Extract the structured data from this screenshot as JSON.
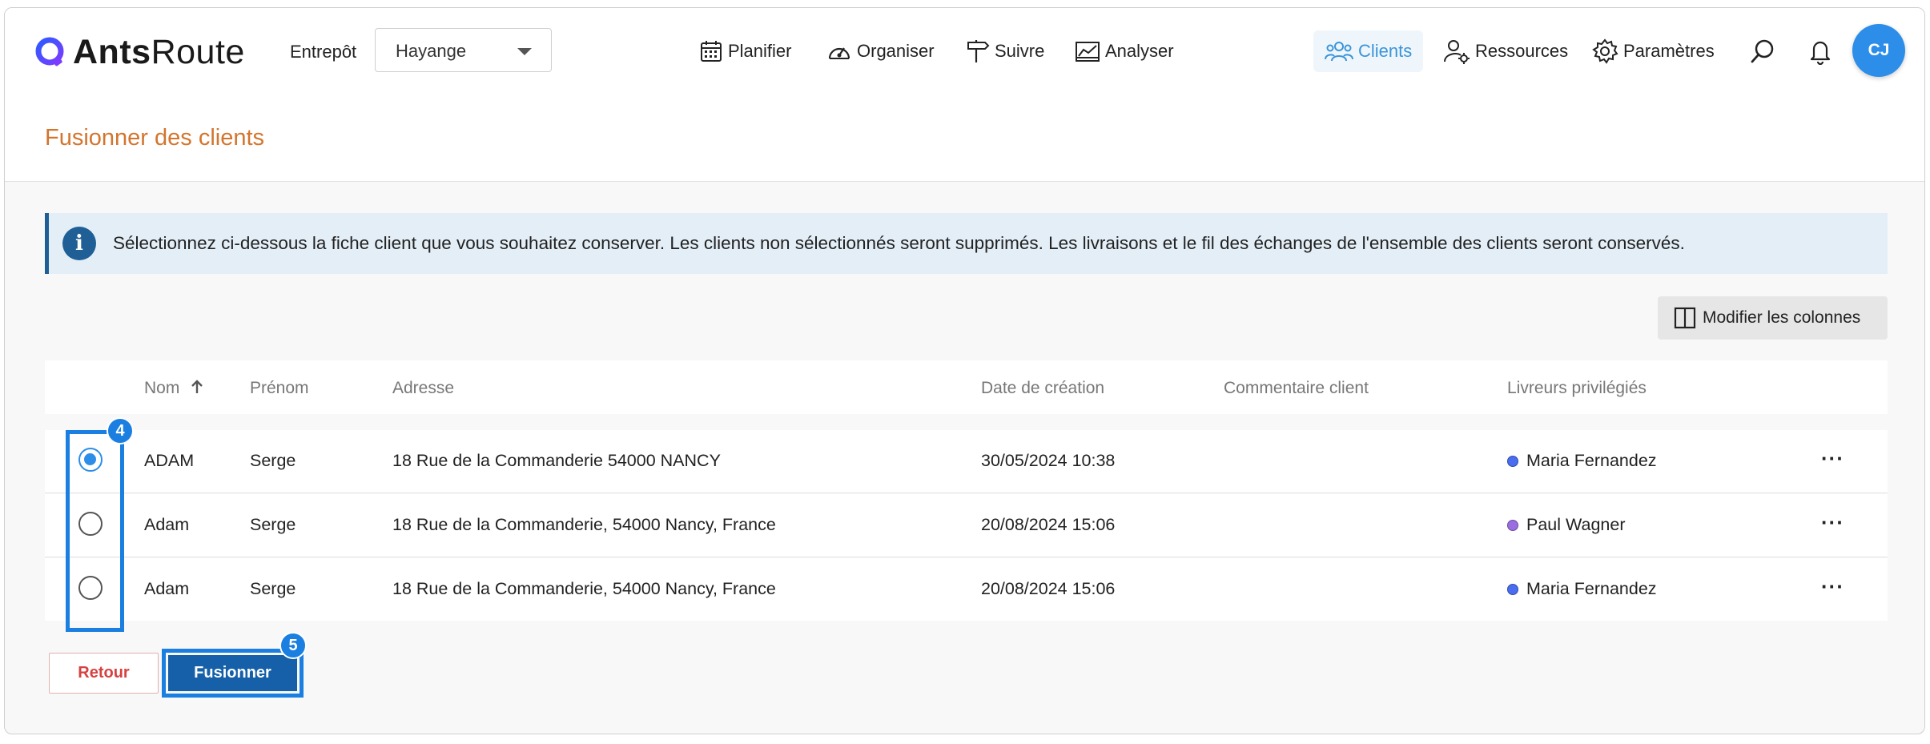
{
  "app": {
    "logo_bold": "Ants",
    "logo_light": "Route"
  },
  "header": {
    "warehouse_label": "Entrepôt",
    "warehouse_value": "Hayange",
    "nav": {
      "plan": "Planifier",
      "organise": "Organiser",
      "track": "Suivre",
      "analyse": "Analyser",
      "clients": "Clients",
      "resources": "Ressources",
      "settings": "Paramètres"
    },
    "avatar_initials": "CJ"
  },
  "page": {
    "title": "Fusionner des clients",
    "info_icon": "i",
    "info_text": "Sélectionnez ci-dessous la fiche client que vous souhaitez conserver. Les clients non sélectionnés seront supprimés. Les livraisons et le fil des échanges de l'ensemble des clients seront conservés.",
    "columns_button": "Modifier les colonnes"
  },
  "table": {
    "headers": {
      "name": "Nom",
      "firstname": "Prénom",
      "address": "Adresse",
      "created": "Date de création",
      "comment": "Commentaire client",
      "drivers": "Livreurs privilégiés"
    },
    "sort": "name-ascending",
    "rows": [
      {
        "selected": true,
        "name": "ADAM",
        "firstname": "Serge",
        "address": "18 Rue de la Commanderie 54000 NANCY",
        "created": "30/05/2024 10:38",
        "comment": "",
        "driver": "Maria Fernandez",
        "driver_color": "#4a6cf0",
        "more": "···"
      },
      {
        "selected": false,
        "name": "Adam",
        "firstname": "Serge",
        "address": "18 Rue de la Commanderie, 54000 Nancy, France",
        "created": "20/08/2024 15:06",
        "comment": "",
        "driver": "Paul Wagner",
        "driver_color": "#9a6ee0",
        "more": "···"
      },
      {
        "selected": false,
        "name": "Adam",
        "firstname": "Serge",
        "address": "18 Rue de la Commanderie, 54000 Nancy, France",
        "created": "20/08/2024 15:06",
        "comment": "",
        "driver": "Maria Fernandez",
        "driver_color": "#4a6cf0",
        "more": "···"
      }
    ]
  },
  "actions": {
    "back": "Retour",
    "merge": "Fusionner"
  },
  "annotations": {
    "step_radio": "4",
    "step_merge": "5"
  },
  "colors": {
    "accent": "#2c8ee8",
    "title": "#d3752e",
    "primary": "#1560a8",
    "danger": "#d74141",
    "highlight": "#1a7fe0"
  }
}
